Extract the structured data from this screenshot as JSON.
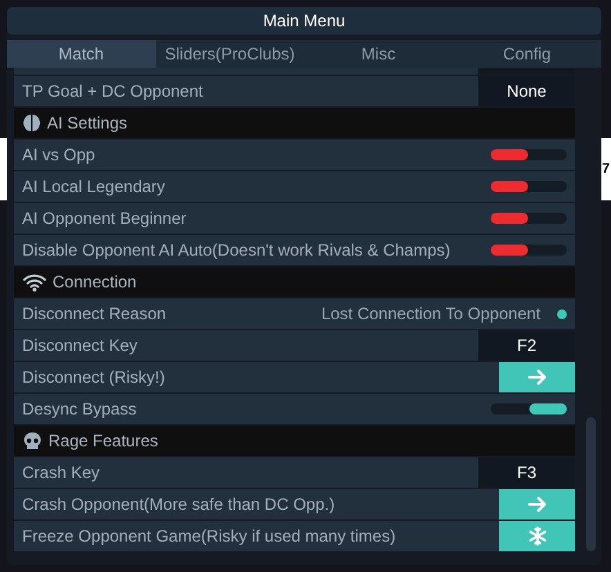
{
  "backdrop": {
    "text": "7"
  },
  "title": "Main Menu",
  "tabs": [
    {
      "label": "Match",
      "selected": true
    },
    {
      "label": "Sliders(ProClubs)",
      "selected": false
    },
    {
      "label": "Misc",
      "selected": false
    },
    {
      "label": "Config",
      "selected": false
    }
  ],
  "rows": [
    {
      "kind": "key",
      "label": "TP Goal + DC Opponent",
      "value": "None"
    },
    {
      "kind": "header",
      "label": "AI Settings"
    },
    {
      "kind": "toggle",
      "label": "AI vs Opp",
      "on": false
    },
    {
      "kind": "toggle",
      "label": "AI Local Legendary",
      "on": false
    },
    {
      "kind": "toggle",
      "label": "AI Opponent Beginner",
      "on": false
    },
    {
      "kind": "toggle",
      "label": "Disable Opponent AI Auto(Doesn't work Rivals & Champs)",
      "on": false
    },
    {
      "kind": "header",
      "label": "Connection"
    },
    {
      "kind": "status",
      "label": "Disconnect Reason",
      "value": "Lost Connection To Opponent",
      "color": "#3ec9b6"
    },
    {
      "kind": "key",
      "label": "Disconnect Key",
      "value": "F2"
    },
    {
      "kind": "action",
      "label": "Disconnect (Risky!)"
    },
    {
      "kind": "toggle",
      "label": "Desync Bypass",
      "on": true
    },
    {
      "kind": "header",
      "label": "Rage Features"
    },
    {
      "kind": "key",
      "label": "Crash Key",
      "value": "F3"
    },
    {
      "kind": "action",
      "label": "Crash Opponent(More safe than DC Opp.)"
    },
    {
      "kind": "freeze",
      "label": "Freeze Opponent Game(Risky if used many times)"
    }
  ]
}
